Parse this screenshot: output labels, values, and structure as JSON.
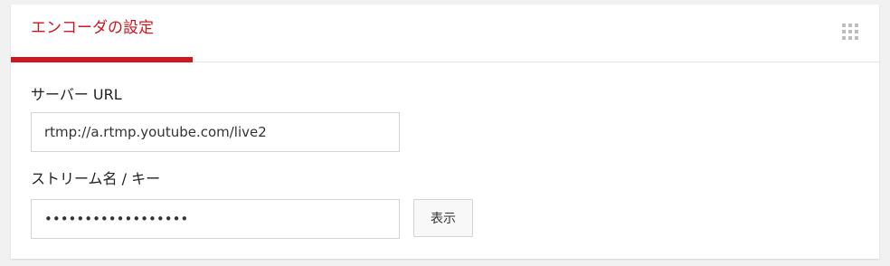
{
  "tabs": {
    "active_label": "エンコーダの設定",
    "accent_color": "#cc181e"
  },
  "toolbar": {
    "menu_icon": "grid-icon"
  },
  "server": {
    "label": "サーバー URL",
    "value": "rtmp://a.rtmp.youtube.com/live2"
  },
  "stream": {
    "label": "ストリーム名 / キー",
    "masked_value": "••••••••••••••••••",
    "show_button_label": "表示"
  }
}
